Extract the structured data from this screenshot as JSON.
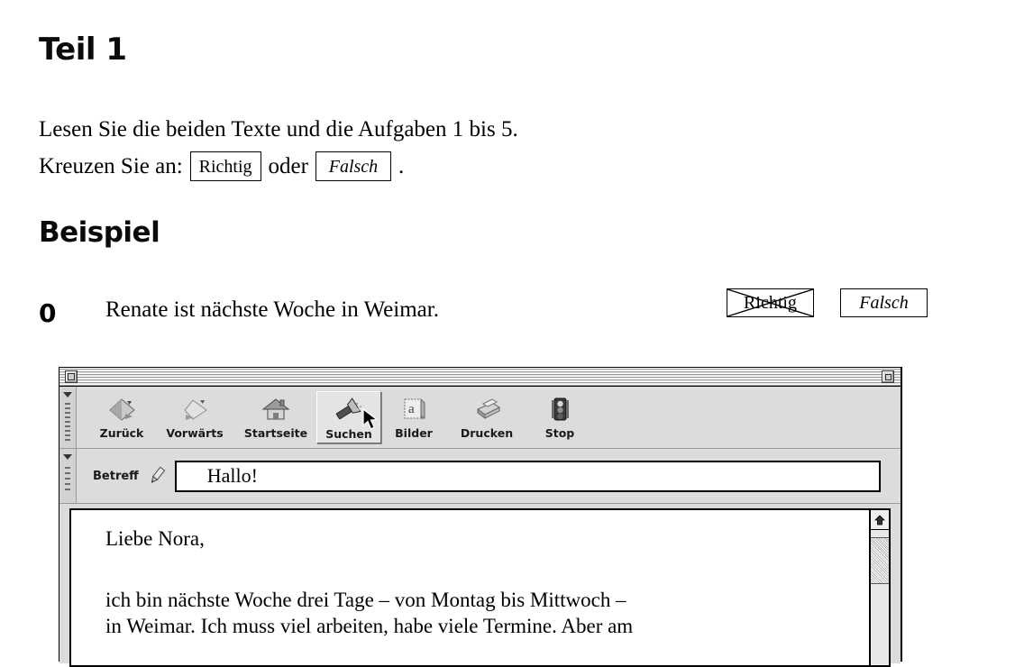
{
  "worksheet": {
    "part_heading": "Teil 1",
    "instruction_line1": "Lesen Sie die beiden Texte und die Aufgaben 1 bis 5.",
    "instruction_prefix": "Kreuzen Sie an:",
    "choice_true": "Richtig",
    "conjunction": "oder",
    "choice_false": "Falsch",
    "instruction_period": ".",
    "example_heading": "Beispiel",
    "example": {
      "number": "0",
      "statement": "Renate ist nächste Woche in Weimar.",
      "answer_true_label": "Richtig",
      "answer_false_label": "Falsch",
      "marked_answer": "Richtig"
    }
  },
  "mac_window": {
    "toolbar": {
      "buttons": [
        {
          "label": "Zurück",
          "icon": "back-arrow-icon",
          "selected": false
        },
        {
          "label": "Vorwärts",
          "icon": "forward-arrow-icon",
          "selected": false
        },
        {
          "label": "Startseite",
          "icon": "home-house-icon",
          "selected": false
        },
        {
          "label": "Suchen",
          "icon": "flashlight-search-icon",
          "selected": true
        },
        {
          "label": "Bilder",
          "icon": "images-picture-icon",
          "selected": false
        },
        {
          "label": "Drucken",
          "icon": "printer-icon",
          "selected": false
        },
        {
          "label": "Stop",
          "icon": "traffic-light-stop-icon",
          "selected": false
        }
      ]
    },
    "subject": {
      "label": "Betreff",
      "icon": "pencil-edit-icon",
      "value": "Hallo!"
    },
    "message_body": {
      "salutation": "Liebe Nora,",
      "paragraph1_line1": "ich bin nächste Woche drei Tage – von Montag bis Mittwoch –",
      "paragraph1_line2": "in Weimar. Ich muss viel arbeiten, habe viele Termine. Aber am"
    },
    "controls": {
      "close_box": "close-box",
      "zoom_box": "zoom-box",
      "scroll_up": "scroll-up-arrow"
    }
  },
  "colors": {
    "window_chrome": "#dcdcdc",
    "titlebar": "#d4d4d4",
    "text": "#000000",
    "field_background": "#ffffff"
  }
}
